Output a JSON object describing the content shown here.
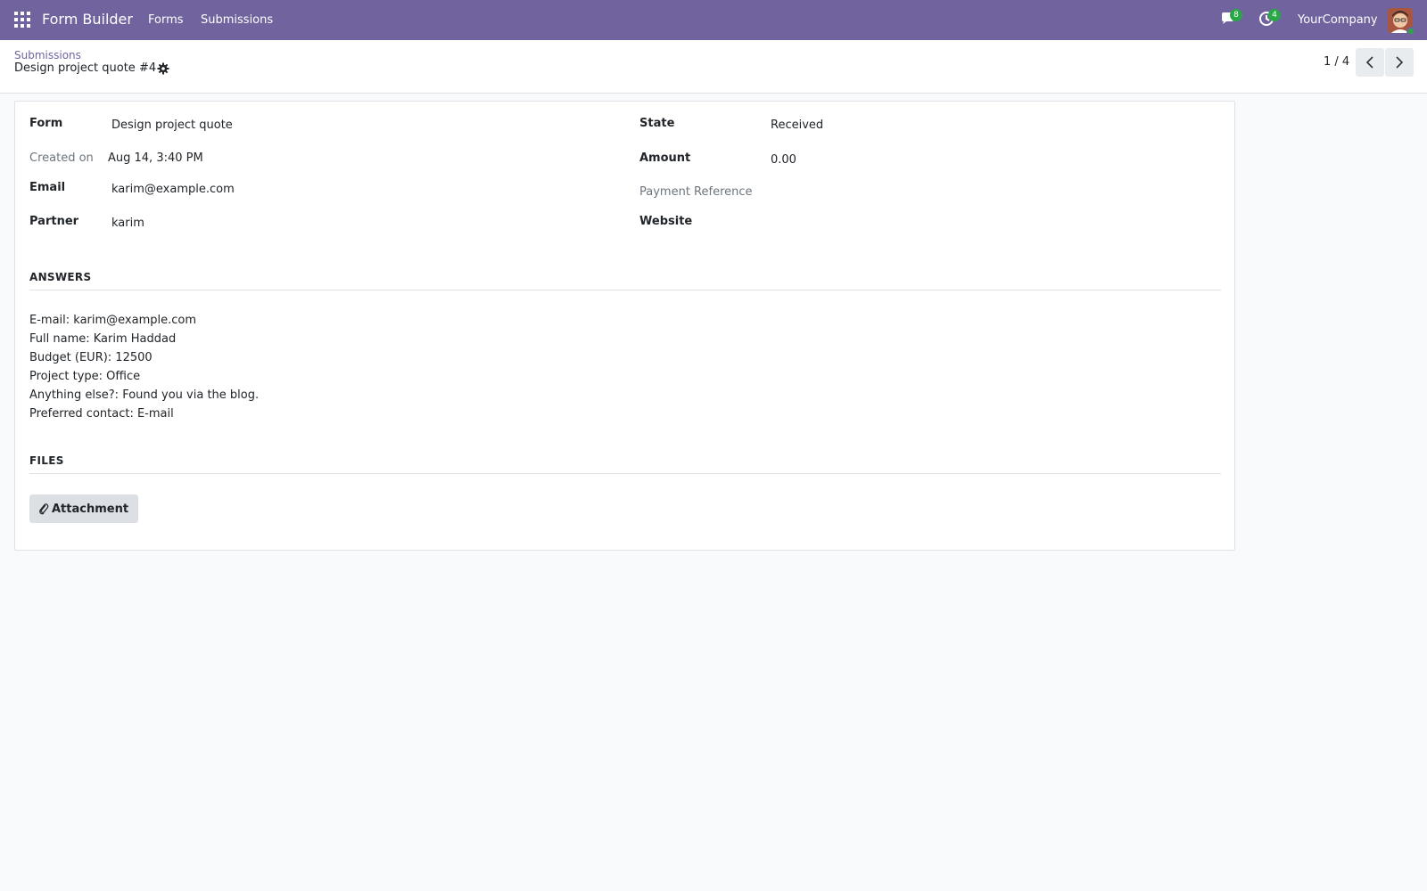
{
  "navbar": {
    "brand": "Form Builder",
    "menu": [
      "Forms",
      "Submissions"
    ],
    "messages_count": "8",
    "activities_count": "4",
    "company": "YourCompany",
    "background_color": "#71639e"
  },
  "breadcrumb": {
    "parent": "Submissions",
    "current": "Design project quote #4"
  },
  "pager": {
    "value": "1 / 4"
  },
  "fields": {
    "form_label": "Form",
    "form_value": "Design project quote",
    "created_label": "Created on",
    "created_value": "Aug 14, 3:40 PM",
    "email_label": "Email",
    "email_value": "karim@example.com",
    "partner_label": "Partner",
    "partner_value": "karim",
    "state_label": "State",
    "state_value": "Received",
    "amount_label": "Amount",
    "amount_value": "0.00",
    "payment_ref_label": "Payment Reference",
    "website_label": "Website"
  },
  "answers": {
    "title": "ANSWERS",
    "lines": [
      "E-mail: karim@example.com",
      "Full name: Karim Haddad",
      "Budget (EUR): 12500",
      "Project type: Office",
      "Anything else?: Found you via the blog.",
      "Preferred contact: E-mail"
    ]
  },
  "files": {
    "title": "FILES",
    "attachment_label": "Attachment"
  },
  "icons": [
    "apps-grid-icon",
    "chat-icon",
    "clock-icon",
    "gear-icon",
    "chevron-left-icon",
    "chevron-right-icon",
    "paperclip-icon"
  ]
}
